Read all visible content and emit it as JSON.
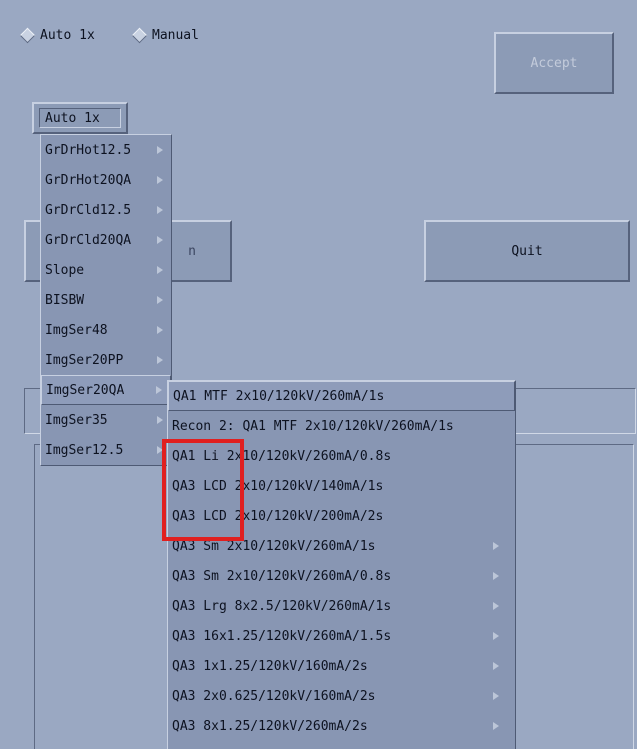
{
  "mode_radios": [
    {
      "label": "Auto 1x"
    },
    {
      "label": "Manual"
    }
  ],
  "accept_label": "Accept",
  "quit_label": "Quit",
  "hidden_button_fragment": "n",
  "option_button_label": "Auto 1x",
  "main_menu": {
    "items": [
      {
        "label": "GrDrHot12.5"
      },
      {
        "label": "GrDrHot20QA"
      },
      {
        "label": "GrDrCld12.5"
      },
      {
        "label": "GrDrCld20QA"
      },
      {
        "label": "Slope"
      },
      {
        "label": "BISBW"
      },
      {
        "label": "ImgSer48"
      },
      {
        "label": "ImgSer20PP"
      },
      {
        "label": "ImgSer20QA",
        "selected": true
      },
      {
        "label": "ImgSer35"
      },
      {
        "label": "ImgSer12.5"
      }
    ]
  },
  "submenu": {
    "items": [
      {
        "label": "QA1 MTF 2x10/120kV/260mA/1s",
        "has_submenu": false,
        "selected": true
      },
      {
        "label": "Recon 2: QA1 MTF 2x10/120kV/260mA/1s",
        "has_submenu": false
      },
      {
        "label": "QA1 Li 2x10/120kV/260mA/0.8s",
        "has_submenu": false
      },
      {
        "label": "QA3 LCD 2x10/120kV/140mA/1s",
        "has_submenu": false
      },
      {
        "label": "QA3 LCD 2x10/120kV/200mA/2s",
        "has_submenu": false
      },
      {
        "label": "QA3 Sm 2x10/120kV/260mA/1s",
        "has_submenu": true
      },
      {
        "label": "QA3 Sm 2x10/120kV/260mA/0.8s",
        "has_submenu": true
      },
      {
        "label": "QA3 Lrg 8x2.5/120kV/260mA/1s",
        "has_submenu": true
      },
      {
        "label": "QA3 16x1.25/120kV/260mA/1.5s",
        "has_submenu": true
      },
      {
        "label": "QA3 1x1.25/120kV/160mA/2s",
        "has_submenu": true
      },
      {
        "label": "QA3 2x0.625/120kV/160mA/2s",
        "has_submenu": true
      },
      {
        "label": "QA3 8x1.25/120kV/260mA/2s",
        "has_submenu": true
      }
    ]
  },
  "annotation_color": "#e02020"
}
